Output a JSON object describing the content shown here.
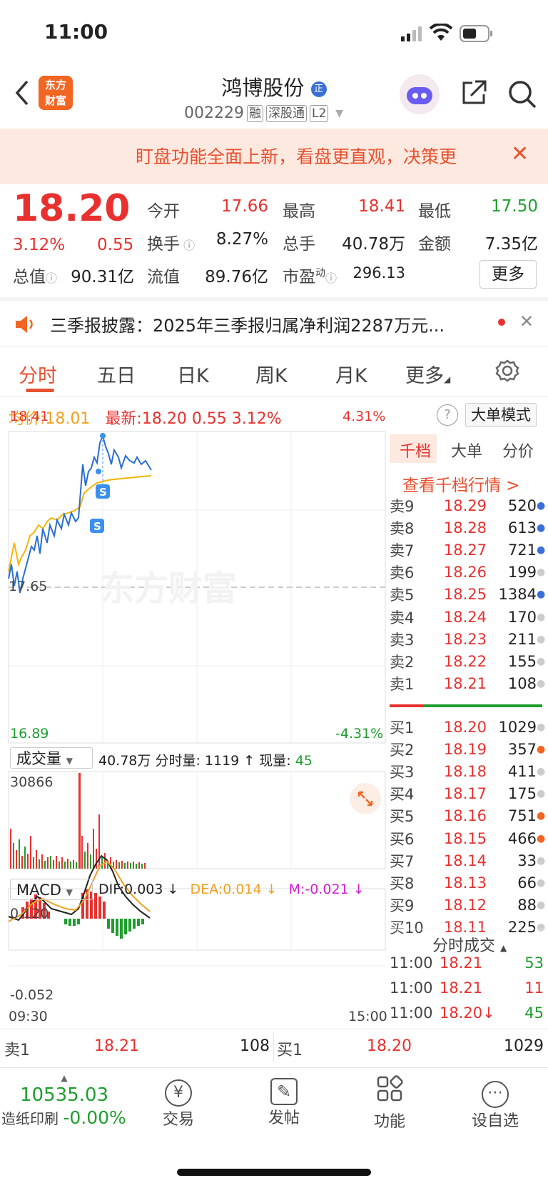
{
  "status_time": "11:00",
  "header": {
    "name": "鸿博股份",
    "code": "002229",
    "tags": [
      "融",
      "深股通",
      "L2"
    ],
    "logo": "东方财富"
  },
  "banner": {
    "text": "盯盘功能全面上新，看盘更直观，决策更"
  },
  "quote": {
    "price": "18.20",
    "change_pct": "3.12%",
    "change": "0.55",
    "open_label": "今开",
    "open": "17.66",
    "high_label": "最高",
    "high": "18.41",
    "low_label": "最低",
    "low": "17.50",
    "turnover_label": "换手",
    "turnover": "8.27%",
    "volume_label": "总手",
    "volume": "40.78万",
    "amount_label": "金额",
    "amount": "7.35亿",
    "mktcap_label": "总值",
    "mktcap": "90.31亿",
    "float_label": "流值",
    "float_cap": "89.76亿",
    "pe_label": "市盈",
    "pe_sup": "动",
    "pe": "296.13",
    "more": "更多"
  },
  "news": {
    "text": "三季报披露：2025年三季报归属净利润2287万元..."
  },
  "tabs": [
    "分时",
    "五日",
    "日K",
    "周K",
    "月K",
    "更多"
  ],
  "info": {
    "avg_label": "均价:",
    "avg": "18.01",
    "last_label": "最新:",
    "last": "18.20",
    "chg": "0.55",
    "pct": "3.12%",
    "mode": "大单模式"
  },
  "chart": {
    "y_max": "18.41",
    "y_min": "16.89",
    "pct_max": "4.31%",
    "pct_min": "-4.31%",
    "ref": "17.65",
    "watermark": "东方财富",
    "vol_label": "成交量",
    "vol_info": "40.78万",
    "vol_detail": "分时量: 1119 ↑ 现量:",
    "vol_now": "45",
    "vol_max": "30866",
    "macd_label": "MACD",
    "dif": "DIF:0.003 ↓",
    "dea": "DEA:0.014 ↓",
    "m": "M:-0.021 ↓",
    "macd_max": "0.120",
    "macd_min": "-0.052",
    "t_start": "09:30",
    "t_end": "15:00"
  },
  "orderbook": {
    "tabs": [
      "千档",
      "大单",
      "分价"
    ],
    "link": "查看千档行情 >",
    "asks": [
      {
        "n": "卖9",
        "p": "18.29",
        "v": "520",
        "c": "#3b6fd8"
      },
      {
        "n": "卖8",
        "p": "18.28",
        "v": "613",
        "c": "#3b6fd8"
      },
      {
        "n": "卖7",
        "p": "18.27",
        "v": "721",
        "c": "#3b6fd8"
      },
      {
        "n": "卖6",
        "p": "18.26",
        "v": "199",
        "c": "#cccccc"
      },
      {
        "n": "卖5",
        "p": "18.25",
        "v": "1384",
        "c": "#3b6fd8"
      },
      {
        "n": "卖4",
        "p": "18.24",
        "v": "170",
        "c": "#cccccc"
      },
      {
        "n": "卖3",
        "p": "18.23",
        "v": "211",
        "c": "#cccccc"
      },
      {
        "n": "卖2",
        "p": "18.22",
        "v": "155",
        "c": "#cccccc"
      },
      {
        "n": "卖1",
        "p": "18.21",
        "v": "108",
        "c": "#cccccc"
      }
    ],
    "bids": [
      {
        "n": "买1",
        "p": "18.20",
        "v": "1029",
        "c": "#cccccc"
      },
      {
        "n": "买2",
        "p": "18.19",
        "v": "357",
        "c": "#f26522"
      },
      {
        "n": "买3",
        "p": "18.18",
        "v": "411",
        "c": "#cccccc"
      },
      {
        "n": "买4",
        "p": "18.17",
        "v": "175",
        "c": "#cccccc"
      },
      {
        "n": "买5",
        "p": "18.16",
        "v": "751",
        "c": "#f26522"
      },
      {
        "n": "买6",
        "p": "18.15",
        "v": "466",
        "c": "#f26522"
      },
      {
        "n": "买7",
        "p": "18.14",
        "v": "33",
        "c": "#cccccc"
      },
      {
        "n": "买8",
        "p": "18.13",
        "v": "66",
        "c": "#cccccc"
      },
      {
        "n": "买9",
        "p": "18.12",
        "v": "88",
        "c": "#cccccc"
      },
      {
        "n": "买10",
        "p": "18.11",
        "v": "225",
        "c": "#cccccc"
      }
    ],
    "ticks_title": "分时成交",
    "ticks": [
      {
        "t": "11:00",
        "p": "18.21",
        "v": "53",
        "vc": "green"
      },
      {
        "t": "11:00",
        "p": "18.21",
        "v": "11",
        "vc": "red"
      },
      {
        "t": "11:00",
        "p": "18.20↓",
        "v": "45",
        "vc": "green"
      }
    ]
  },
  "bottom_quote": {
    "ask_label": "卖1",
    "ask": "18.21",
    "ask_vol": "108",
    "bid_label": "买1",
    "bid": "18.20",
    "bid_vol": "1029"
  },
  "bottom_nav": {
    "index_value": "10535.03",
    "index_name": "造纸印刷",
    "index_pct": "-0.00%",
    "items": [
      {
        "label": "交易",
        "icon": "¥"
      },
      {
        "label": "发帖",
        "icon": "✎"
      },
      {
        "label": "功能",
        "icon": "▦"
      },
      {
        "label": "设自选",
        "icon": "⋯"
      }
    ]
  }
}
